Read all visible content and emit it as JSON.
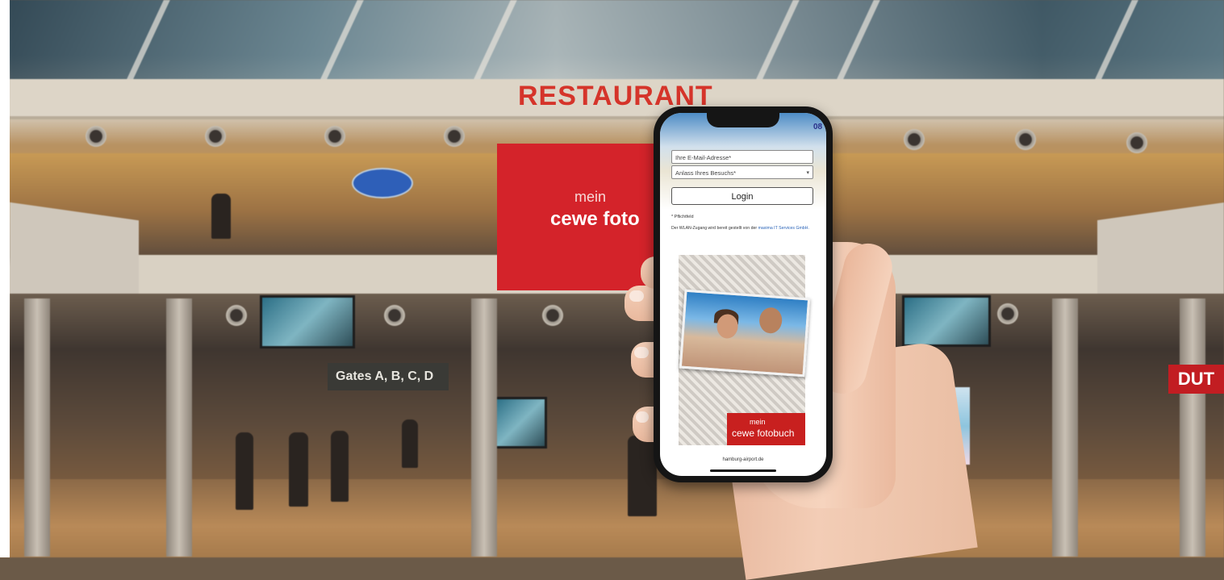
{
  "background": {
    "restaurant_sign": "RESTAURANT",
    "banner_mein": "mein",
    "banner_brand": "cewe foto",
    "gates_sign": "Gates A, B, C, D",
    "duty_sign": "DUT"
  },
  "phone_screen": {
    "corner_text": "08",
    "email_placeholder": "Ihre E-Mail-Adresse*",
    "visit_reason_select": "Anlass Ihres Besuchs*",
    "login_button": "Login",
    "required_note": "* Pflichtfeld",
    "wlan_text": "Der WLAN-Zugang wird bereit gestellt von der",
    "wlan_link": "maxima IT Services GmbH.",
    "ad_mein": "mein",
    "ad_brand": "cewe fotobuch",
    "domain": "hamburg-airport.de"
  },
  "colors": {
    "brand_red": "#c8201f",
    "sign_red": "#d5342a",
    "link_blue": "#2b64b8"
  }
}
